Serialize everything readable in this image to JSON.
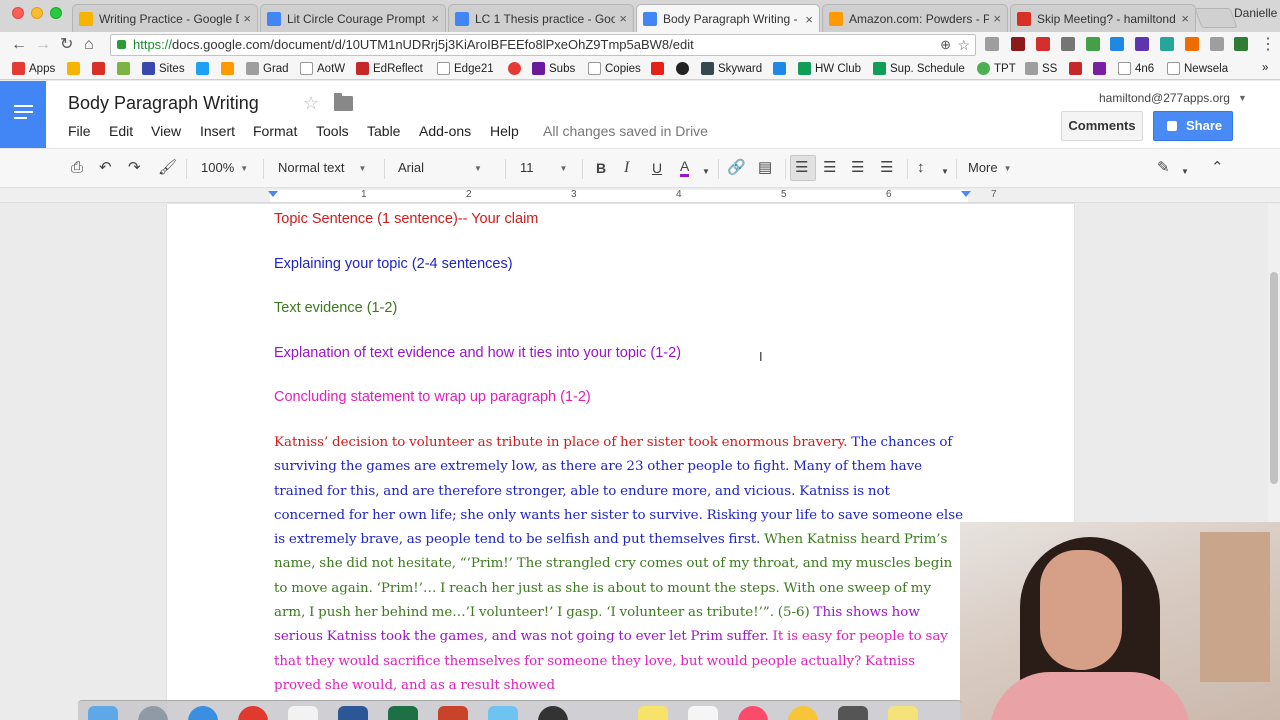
{
  "browser": {
    "tabs": [
      {
        "title": "Writing Practice - Google D",
        "color": "#f6b400"
      },
      {
        "title": "Lit Circle Courage Prompt",
        "color": "#4285f4"
      },
      {
        "title": "LC 1 Thesis practice - Goo",
        "color": "#4285f4"
      },
      {
        "title": "Body Paragraph Writing - G",
        "color": "#4285f4"
      },
      {
        "title": "Amazon.com: Powders - Pr",
        "color": "#ff9900"
      },
      {
        "title": "Skip Meeting? - hamiltond",
        "color": "#d93025"
      }
    ],
    "tab_close_glyph": "×",
    "profile_name": "Danielle",
    "url_secure": "https://",
    "url_rest": "docs.google.com/document/d/10UTM1nUDRrj5j3KiAroIBFEEfo8lPxeOhZ9Tmp5aBW8/edit",
    "zoom_glyph": "⊕",
    "star_glyph": "☆"
  },
  "bookmarks": [
    "Apps",
    "Sites",
    "Grad",
    "AotW",
    "EdReflect",
    "Edge21",
    "Subs",
    "Copies",
    "Skyward",
    "HW Club",
    "Sup. Schedule",
    "TPT",
    "SS",
    "4n6",
    "Newsela"
  ],
  "docs": {
    "title": "Body Paragraph Writing",
    "menu": [
      "File",
      "Edit",
      "View",
      "Insert",
      "Format",
      "Tools",
      "Table",
      "Add-ons",
      "Help"
    ],
    "save_status": "All changes saved in Drive",
    "account": "hamiltond@277apps.org",
    "comments_label": "Comments",
    "share_label": "Share"
  },
  "toolbar": {
    "zoom": "100%",
    "style": "Normal text",
    "font": "Arial",
    "size": "11",
    "bold": "B",
    "italic": "I",
    "underline": "U",
    "text_color": "A",
    "more": "More"
  },
  "ruler": [
    "1",
    "2",
    "3",
    "4",
    "5",
    "6",
    "7"
  ],
  "document": {
    "outline": [
      {
        "text": "Topic Sentence (1 sentence)-- Your claim",
        "color": "red"
      },
      {
        "text": "Explaining your topic (2-4 sentences)",
        "color": "blue"
      },
      {
        "text": "Text evidence (1-2)",
        "color": "green"
      },
      {
        "text": "Explanation of text evidence and how it ties into your topic (1-2)",
        "color": "purple"
      },
      {
        "text": "Concluding statement to wrap up paragraph (1-2)",
        "color": "pink"
      }
    ],
    "paragraph": {
      "topic": "Katniss’ decision to volunteer as tribute in place of her sister took enormous bravery.",
      "explain": "The chances of surviving the games are extremely low, as there are 23 other people to fight. Many of them have trained for this, and are therefore stronger, able to endure more, and vicious. Katniss is not concerned for her own life; she only wants her sister to survive. Risking your life to save someone else is extremely brave, as people tend to be selfish and put themselves first.",
      "evidence": "When Katniss heard Prim’s name, she did not hesitate, “‘Prim!’ The strangled cry comes out of my throat, and my muscles begin to move again. ‘Prim!’… I reach her just as she is about to mount the steps. With one sweep of my arm, I push her behind me…’I volunteer!’ I gasp. ‘I volunteer as tribute!’”. (5-6)",
      "explanation": "This shows how serious Katniss took the games, and was not going to ever let Prim suffer.",
      "conclusion": "It is easy for people to say that they would sacrifice themselves for someone they love, but would people actually? Katniss proved she would, and as a result showed"
    }
  }
}
